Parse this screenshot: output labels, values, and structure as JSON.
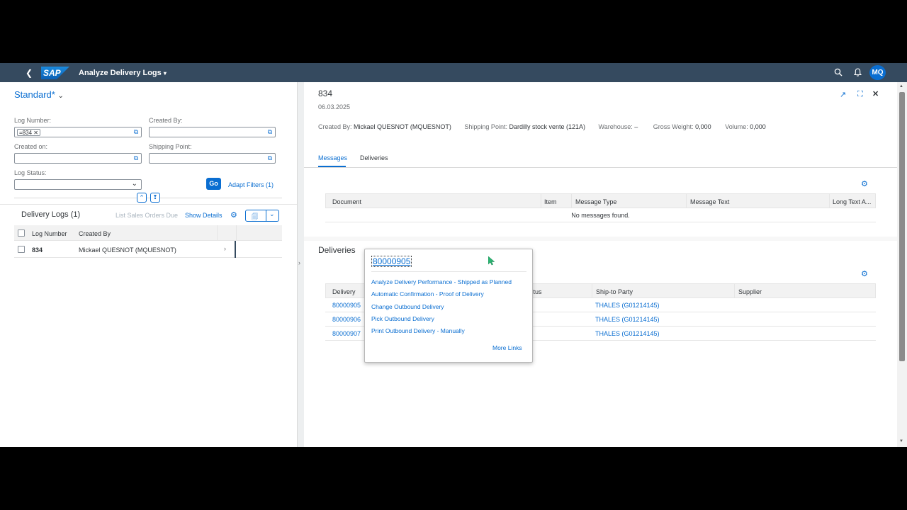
{
  "shell": {
    "logo": "SAP",
    "title": "Analyze Delivery Logs",
    "avatar": "MQ"
  },
  "filter": {
    "variant": "Standard*",
    "log_number_label": "Log Number:",
    "log_number_token": "=834",
    "created_by_label": "Created By:",
    "created_on_label": "Created on:",
    "shipping_point_label": "Shipping Point:",
    "log_status_label": "Log Status:",
    "go": "Go",
    "adapt_filters": "Adapt Filters (1)"
  },
  "logs_table": {
    "title": "Delivery Logs (1)",
    "list_sales_orders_due": "List Sales Orders Due",
    "show_details": "Show Details",
    "columns": [
      "Log Number",
      "Created By"
    ],
    "rows": [
      {
        "log_number": "834",
        "created_by": "Mickael QUESNOT (MQUESNOT)"
      }
    ]
  },
  "detail": {
    "title": "834",
    "date": "06.03.2025",
    "created_by_label": "Created By:",
    "created_by_value": "Mickael QUESNOT (MQUESNOT)",
    "shipping_point_label": "Shipping Point:",
    "shipping_point_value": "Dardilly stock vente (121A)",
    "warehouse_label": "Warehouse:",
    "warehouse_value": "–",
    "gross_weight_label": "Gross Weight:",
    "gross_weight_value": "0,000",
    "volume_label": "Volume:",
    "volume_value": "0,000",
    "tabs": [
      "Messages",
      "Deliveries"
    ],
    "active_tab": "Messages"
  },
  "messages_table": {
    "columns": [
      "Document",
      "Item",
      "Message Type",
      "Message Text",
      "Long Text A..."
    ],
    "empty_text": "No messages found."
  },
  "deliveries": {
    "title": "Deliveries",
    "columns": [
      "Delivery",
      "...tus",
      "Ship-to Party",
      "Supplier"
    ],
    "rows": [
      {
        "delivery": "80000905",
        "ship_to": "THALES (G01214145)"
      },
      {
        "delivery": "80000906",
        "ship_to": "THALES (G01214145)"
      },
      {
        "delivery": "80000907",
        "ship_to": "THALES (G01214145)"
      }
    ]
  },
  "popover": {
    "title": "80000905",
    "links": [
      "Analyze Delivery Performance - Shipped as Planned",
      "Automatic Confirmation - Proof of Delivery",
      "Change Outbound Delivery",
      "Pick Outbound Delivery",
      "Print Outbound Delivery - Manually"
    ],
    "more_links": "More Links"
  },
  "colors": {
    "shell_bg": "#354a5f",
    "accent": "#0a6ed1",
    "cursor": "#2bb673"
  }
}
